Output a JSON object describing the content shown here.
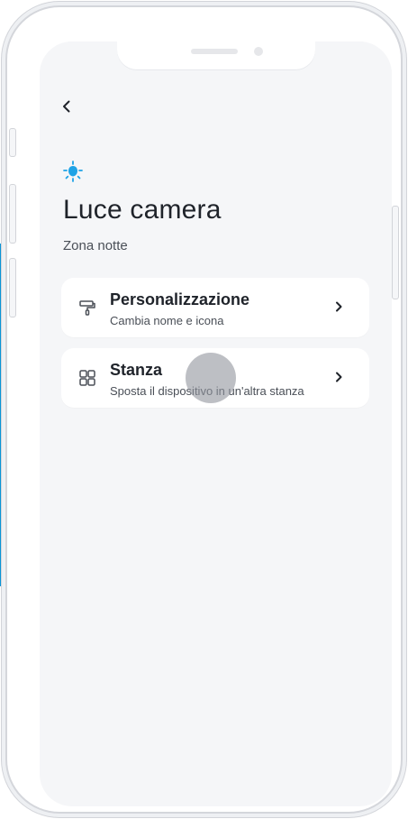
{
  "header": {
    "back_icon": "chevron-left-icon"
  },
  "device": {
    "icon": "light-bulb-icon",
    "icon_color": "#1ea3e6",
    "name": "Luce camera",
    "zone": "Zona notte"
  },
  "menu": {
    "items": [
      {
        "icon": "paint-roller-icon",
        "title": "Personalizzazione",
        "subtitle": "Cambia nome e icona",
        "chevron_icon": "chevron-right-icon"
      },
      {
        "icon": "grid-icon",
        "title": "Stanza",
        "subtitle": "Sposta il dispositivo in un'altra stanza",
        "chevron_icon": "chevron-right-icon"
      }
    ]
  },
  "colors": {
    "accent": "#0a94d6",
    "screen_bg": "#f5f6f8",
    "card_bg": "#ffffff",
    "text_primary": "#1f232a",
    "text_secondary": "#4a4f57"
  }
}
